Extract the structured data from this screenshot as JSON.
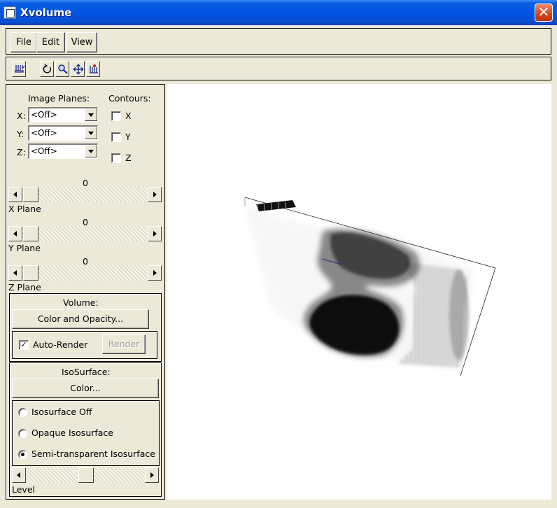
{
  "window": {
    "title": "Xvolume"
  },
  "menu": {
    "file": "File",
    "edit": "Edit",
    "view": "View"
  },
  "toolbar": {
    "icons": [
      "probe-icon",
      "rotate-icon",
      "zoom-icon",
      "pan-icon",
      "pick-icon"
    ]
  },
  "image_planes": {
    "heading": "Image Planes:",
    "x_label": "X:",
    "x_value": "<Off>",
    "y_label": "Y:",
    "y_value": "<Off>",
    "z_label": "Z:",
    "z_value": "<Off>"
  },
  "contours": {
    "heading": "Contours:",
    "x_label": "X",
    "x_checked": false,
    "y_label": "Y",
    "y_checked": false,
    "z_label": "Z",
    "z_checked": false
  },
  "planes": {
    "x": {
      "value": "0",
      "label": "X Plane"
    },
    "y": {
      "value": "0",
      "label": "Y Plane"
    },
    "z": {
      "value": "0",
      "label": "Z Plane"
    }
  },
  "volume": {
    "heading": "Volume:",
    "color_opacity_button": "Color and Opacity...",
    "auto_render_label": "Auto-Render",
    "auto_render_checked": true,
    "render_button": "Render"
  },
  "isosurface": {
    "heading": "IsoSurface:",
    "color_button": "Color...",
    "options": [
      "Isosurface Off",
      "Opaque Isosurface",
      "Semi-transparent Isosurface"
    ],
    "selected": "Semi-transparent Isosurface",
    "level_label": "Level"
  }
}
